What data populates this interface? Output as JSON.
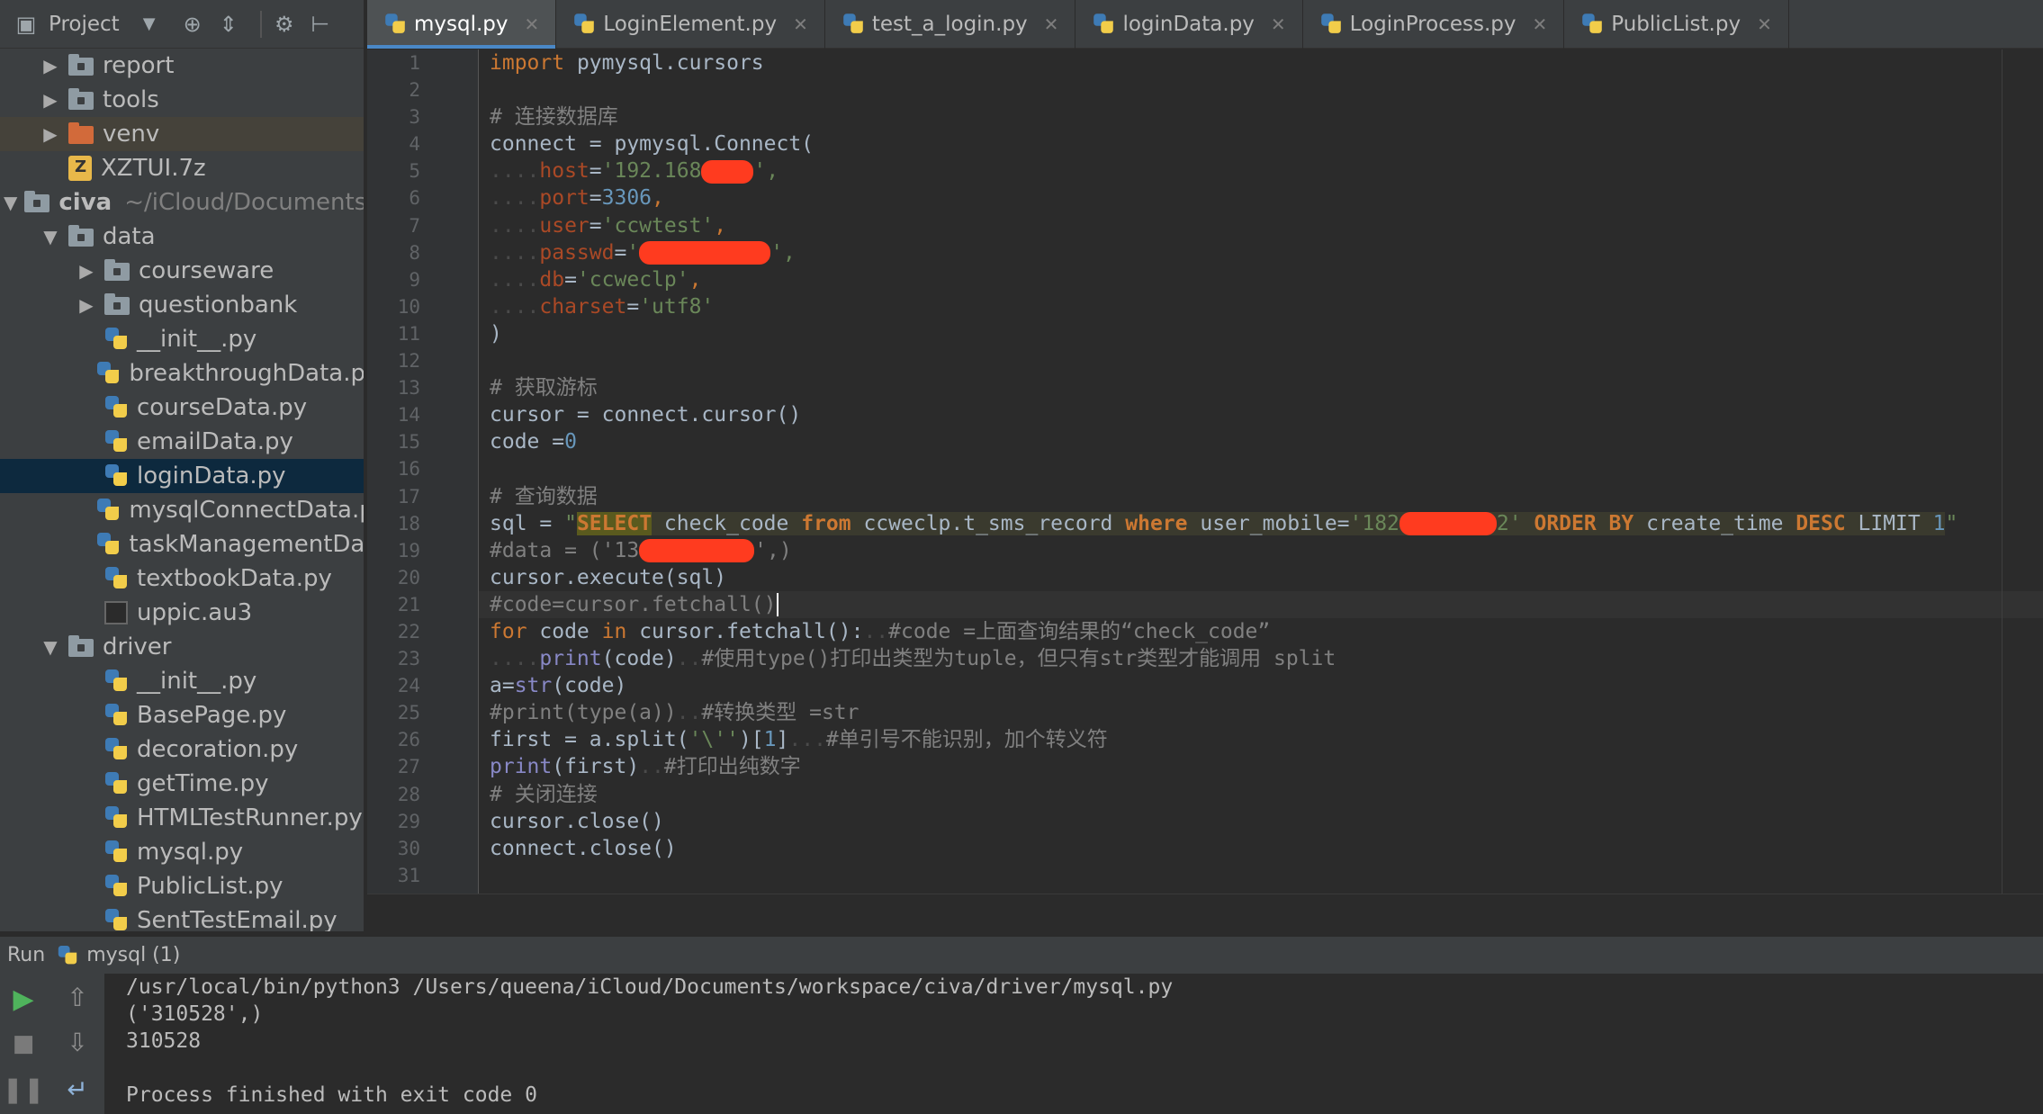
{
  "sidebar": {
    "header_label": "Project",
    "items": [
      {
        "label": "report",
        "type": "folder",
        "depth": 1,
        "arrow": "collapsed"
      },
      {
        "label": "tools",
        "type": "folder",
        "depth": 1,
        "arrow": "collapsed"
      },
      {
        "label": "venv",
        "type": "folder-orange",
        "depth": 1,
        "arrow": "collapsed"
      },
      {
        "label": "XZTUI.7z",
        "type": "archive",
        "depth": 1,
        "arrow": "none"
      },
      {
        "label": "civa",
        "type": "folder",
        "depth": 0,
        "arrow": "expanded",
        "extra": "~/iCloud/Documents/"
      },
      {
        "label": "data",
        "type": "folder",
        "depth": 1,
        "arrow": "expanded"
      },
      {
        "label": "courseware",
        "type": "folder",
        "depth": 2,
        "arrow": "collapsed"
      },
      {
        "label": "questionbank",
        "type": "folder",
        "depth": 2,
        "arrow": "collapsed"
      },
      {
        "label": "__init__.py",
        "type": "py",
        "depth": 2,
        "arrow": "none"
      },
      {
        "label": "breakthroughData.p",
        "type": "py",
        "depth": 2,
        "arrow": "none"
      },
      {
        "label": "courseData.py",
        "type": "py",
        "depth": 2,
        "arrow": "none"
      },
      {
        "label": "emailData.py",
        "type": "py",
        "depth": 2,
        "arrow": "none"
      },
      {
        "label": "loginData.py",
        "type": "py",
        "depth": 2,
        "arrow": "none",
        "selected": true
      },
      {
        "label": "mysqlConnectData.p",
        "type": "py",
        "depth": 2,
        "arrow": "none"
      },
      {
        "label": "taskManagementDat",
        "type": "py",
        "depth": 2,
        "arrow": "none"
      },
      {
        "label": "textbookData.py",
        "type": "py",
        "depth": 2,
        "arrow": "none"
      },
      {
        "label": "uppic.au3",
        "type": "au3",
        "depth": 2,
        "arrow": "none"
      },
      {
        "label": "driver",
        "type": "folder",
        "depth": 1,
        "arrow": "expanded"
      },
      {
        "label": "__init__.py",
        "type": "py",
        "depth": 2,
        "arrow": "none"
      },
      {
        "label": "BasePage.py",
        "type": "py",
        "depth": 2,
        "arrow": "none"
      },
      {
        "label": "decoration.py",
        "type": "py",
        "depth": 2,
        "arrow": "none"
      },
      {
        "label": "getTime.py",
        "type": "py",
        "depth": 2,
        "arrow": "none"
      },
      {
        "label": "HTMLTestRunner.py",
        "type": "py",
        "depth": 2,
        "arrow": "none"
      },
      {
        "label": "mysql.py",
        "type": "py",
        "depth": 2,
        "arrow": "none"
      },
      {
        "label": "PublicList.py",
        "type": "py",
        "depth": 2,
        "arrow": "none"
      },
      {
        "label": "SentTestEmail.py",
        "type": "py",
        "depth": 2,
        "arrow": "none"
      }
    ]
  },
  "tabs": [
    {
      "label": "mysql.py",
      "active": true
    },
    {
      "label": "LoginElement.py",
      "active": false
    },
    {
      "label": "test_a_login.py",
      "active": false
    },
    {
      "label": "loginData.py",
      "active": false
    },
    {
      "label": "LoginProcess.py",
      "active": false
    },
    {
      "label": "PublicList.py",
      "active": false
    }
  ],
  "editor": {
    "line_numbers": [
      "1",
      "2",
      "3",
      "4",
      "5",
      "6",
      "7",
      "8",
      "9",
      "10",
      "11",
      "12",
      "13",
      "14",
      "15",
      "16",
      "17",
      "18",
      "19",
      "20",
      "21",
      "22",
      "23",
      "24",
      "25",
      "26",
      "27",
      "28",
      "29",
      "30",
      "31"
    ],
    "code": {
      "l1_import": "import",
      "l1_mod": " pymysql.cursors",
      "l3": "# 连接数据库",
      "l4": "connect = pymysql.Connect(",
      "l5_param": "host",
      "l5_str": "'192.168",
      "l5_tail": "',",
      "l6_param": "port",
      "l6_num": "3306",
      "l7_param": "user",
      "l7_str": "'ccwtest'",
      "l8_param": "passwd",
      "l8_str": "'",
      "l8_tail": "',",
      "l9_param": "db",
      "l9_str": "'ccweclp'",
      "l10_param": "charset",
      "l10_str": "'utf8'",
      "l11": ")",
      "l13": "# 获取游标",
      "l14": "cursor = connect.cursor()",
      "l15_a": "code =",
      "l15_num": "0",
      "l17": "# 查询数据",
      "l18_a": "sql = ",
      "l18_q": "\"",
      "l18_select": "SELECT",
      "l18_b": " check_code ",
      "l18_from": "from",
      "l18_c": " ccweclp.t_sms_record ",
      "l18_where": "where",
      "l18_d": " user_mobile=",
      "l18_str": "'182",
      "l18_str2": "2'",
      "l18_order": "ORDER BY",
      "l18_e": " create_time ",
      "l18_desc": "DESC",
      "l18_f": " LIMIT ",
      "l18_num": "1",
      "l18_end": "\"",
      "l19_a": "#data = ('13",
      "l19_b": "',)",
      "l20": "cursor.execute(sql)",
      "l21": "#code=cursor.fetchall()",
      "l22_for": "for",
      "l22_a": " code ",
      "l22_in": "in",
      "l22_b": " cursor.fetchall():",
      "l22_cmt": "#code =上面查询结果的“check_code”",
      "l23_print": "print",
      "l23_a": "(code)",
      "l23_cmt": "#使用type()打印出类型为tuple，但只有str类型才能调用 split",
      "l24_a": "a=",
      "l24_str": "str",
      "l24_b": "(code)",
      "l25": "#print(type(a))",
      "l25_cmt": "#转换类型 =str",
      "l26_a": "first = a.split(",
      "l26_str": "'\\''",
      "l26_b": ")[",
      "l26_num": "1",
      "l26_c": "]",
      "l26_cmt": "#单引号不能识别，加个转义符",
      "l27_print": "print",
      "l27_a": "(first)",
      "l27_cmt": "#打印出纯数字",
      "l28": "# 关闭连接",
      "l29": "cursor.close()",
      "l30": "connect.close()"
    }
  },
  "run": {
    "label": "Run",
    "config": "mysql (1)",
    "output": [
      "/usr/local/bin/python3 /Users/queena/iCloud/Documents/workspace/civa/driver/mysql.py",
      "('310528',)",
      "310528",
      "",
      "Process finished with exit code 0"
    ]
  }
}
